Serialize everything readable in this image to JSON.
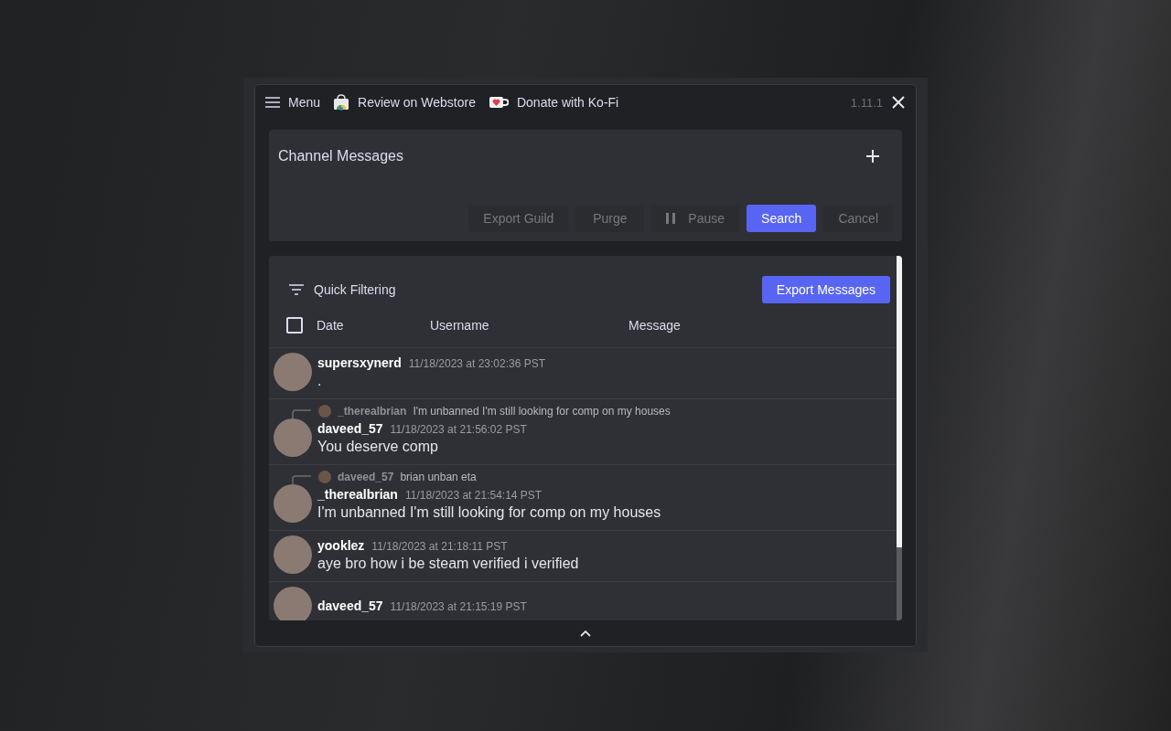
{
  "toolbar": {
    "menu": "Menu",
    "links": [
      {
        "label": "Review on Webstore",
        "kind": "webstore"
      },
      {
        "label": "Donate with Ko-Fi",
        "kind": "kofi"
      }
    ],
    "version": "1.11.1"
  },
  "search_panel": {
    "title": "Channel Messages",
    "buttons": [
      {
        "label": "Export Guild",
        "kind": "plain",
        "disabled": true
      },
      {
        "label": "Purge",
        "kind": "plain",
        "disabled": true
      },
      {
        "label": "Pause",
        "kind": "pause",
        "disabled": true
      },
      {
        "label": "Search",
        "kind": "primary",
        "disabled": false
      },
      {
        "label": "Cancel",
        "kind": "plain",
        "disabled": true
      }
    ]
  },
  "results": {
    "filter_label": "Quick Filtering",
    "export_button": "Export Messages",
    "select_all": {
      "checked": false
    },
    "columns": [
      "Date",
      "Username",
      "Message"
    ],
    "messages": [
      {
        "username": "supersxynerd",
        "timestamp": "11/18/2023 at 23:02:36 PST",
        "text": "."
      },
      {
        "username": "daveed_57",
        "timestamp": "11/18/2023 at 21:56:02 PST",
        "text": "You deserve comp",
        "reply": {
          "username": "_therealbrian",
          "text": "I'm unbanned I'm still looking for comp on my houses"
        }
      },
      {
        "username": "_therealbrian",
        "timestamp": "11/18/2023 at 21:54:14 PST",
        "text": "I'm unbanned I'm still looking for comp on my houses",
        "reply": {
          "username": "daveed_57",
          "text": "brian unban eta"
        }
      },
      {
        "username": "yooklez",
        "timestamp": "11/18/2023 at 21:18:11 PST",
        "text": "aye bro how i be steam verified i verified"
      },
      {
        "username": "daveed_57",
        "timestamp": "11/18/2023 at 21:15:19 PST"
      }
    ]
  }
}
